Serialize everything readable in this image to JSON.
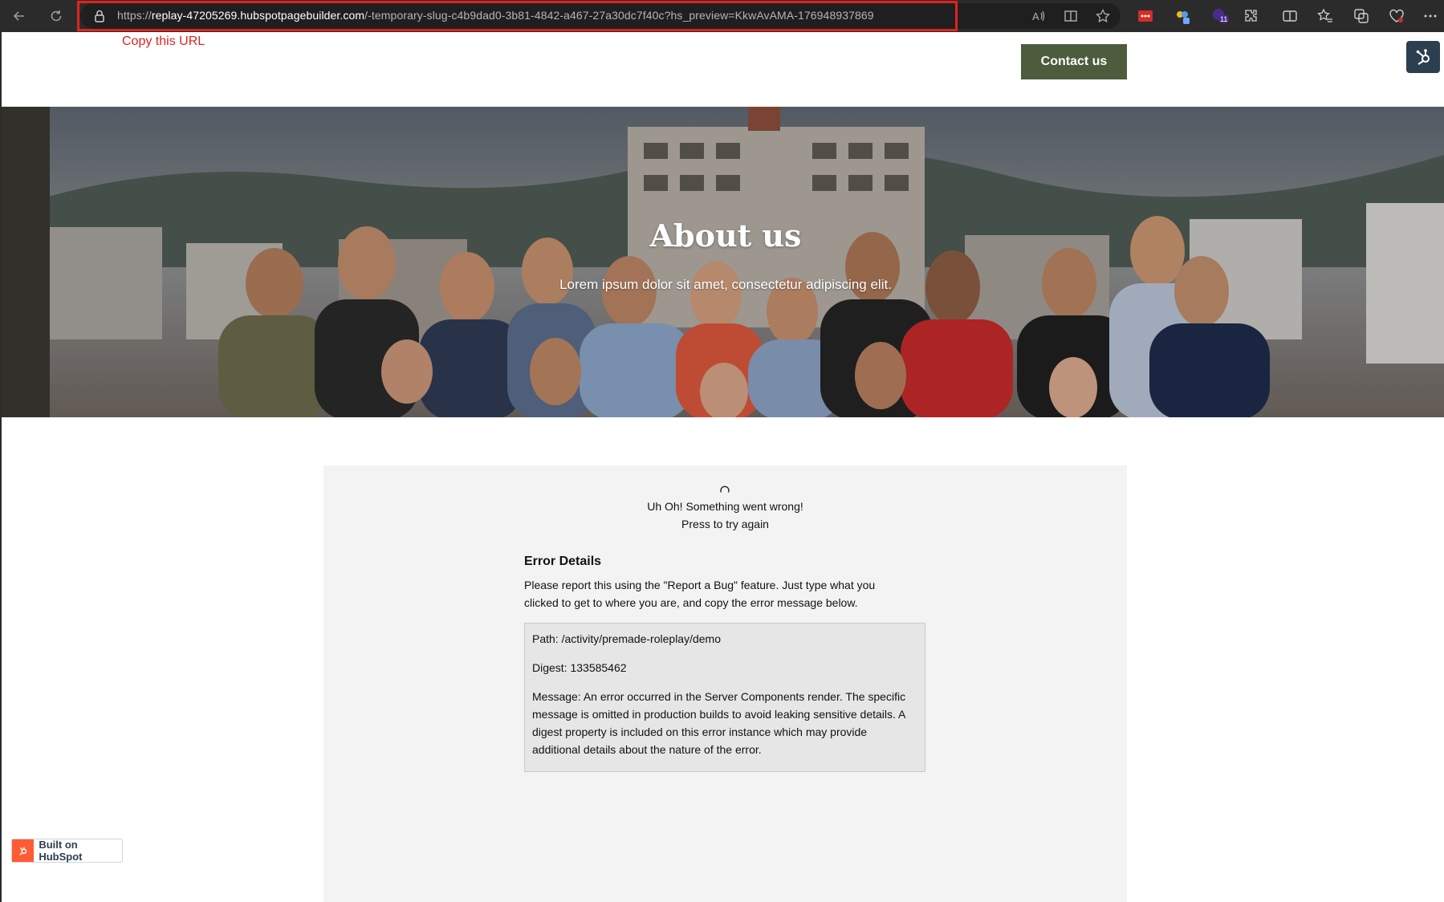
{
  "browser": {
    "url_prefix": "https://",
    "url_domain": "replay-47205269.hubspotpagebuilder.com",
    "url_path": "/-temporary-slug-c4b9dad0-3b81-4842-a467-27a30dc7f40c?hs_preview=KkwAvAMA-176948937869",
    "extension_badge": "11"
  },
  "annotation": {
    "copy_note": "Copy this URL"
  },
  "header": {
    "contact_label": "Contact us"
  },
  "hero": {
    "title": "About us",
    "subtitle": "Lorem ipsum dolor sit amet, consectetur adipiscing elit."
  },
  "error": {
    "headline": "Uh Oh! Something went wrong!",
    "retry": "Press to try again",
    "details_title": "Error Details",
    "details_desc": "Please report this using the \"Report a Bug\" feature. Just type what you clicked to get to where you are, and copy the error message below.",
    "path": "Path: /activity/premade-roleplay/demo",
    "digest": "Digest: 133585462",
    "message": "Message: An error occurred in the Server Components render. The specific message is omitted in production builds to avoid leaking sensitive details. A digest property is included on this error instance which may provide additional details about the nature of the error."
  },
  "footer": {
    "badge_label": "Built on HubSpot"
  },
  "colors": {
    "contact_button": "#4d5c3d",
    "annotation_red": "#e0231f",
    "error_panel": "#f3f3f3",
    "hubspot_orange": "#ff5c35"
  }
}
